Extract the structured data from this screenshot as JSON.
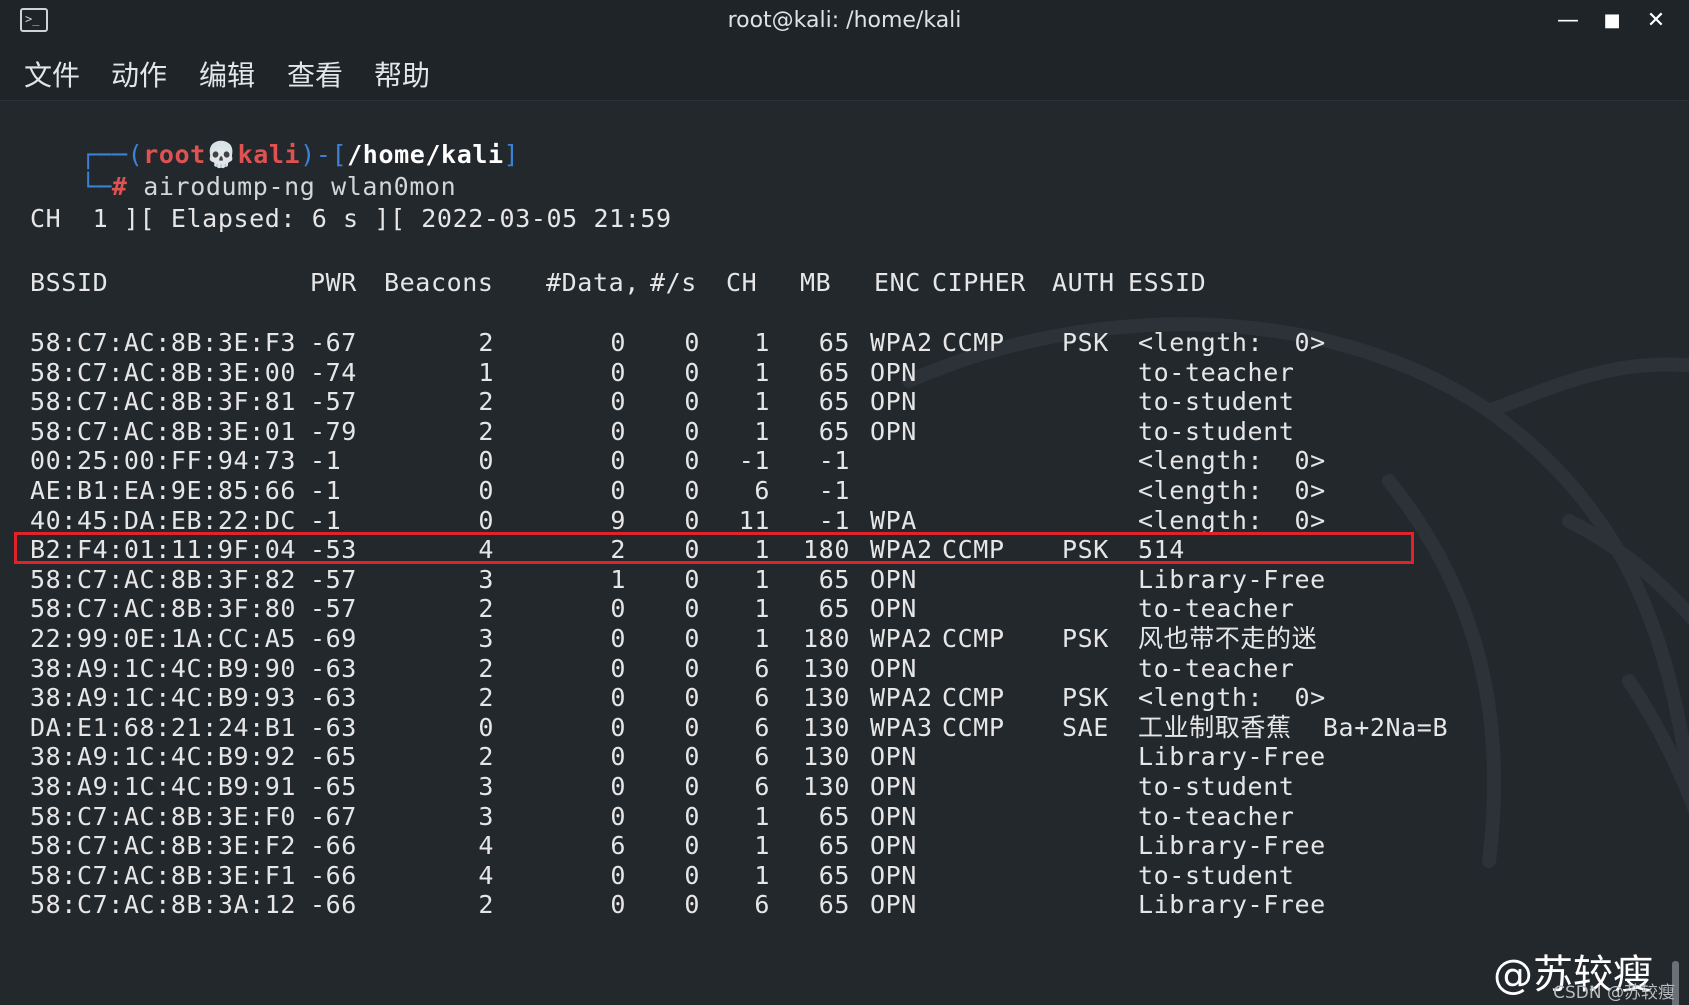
{
  "window": {
    "title": "root@kali: /home/kali",
    "terminal_icon_glyph": ">_",
    "minimize_glyph": "—",
    "maximize_glyph": "■",
    "close_glyph": "✕"
  },
  "menu": [
    "文件",
    "动作",
    "编辑",
    "查看",
    "帮助"
  ],
  "prompt": {
    "open": "┌──(",
    "user": "root",
    "skull": "💀",
    "host": "kali",
    "mid": ")-[",
    "path": "/home/kali",
    "close": "]",
    "corner": "└─",
    "hash": "#",
    "command": "airodump-ng",
    "arg": "wlan0mon"
  },
  "status_line": "CH  1 ][ Elapsed: 6 s ][ 2022-03-05 21:59",
  "columns": [
    "BSSID",
    "PWR",
    "Beacons",
    "#Data,",
    "#/s",
    "CH",
    "MB",
    "ENC",
    "CIPHER",
    "AUTH",
    "ESSID"
  ],
  "rows": [
    {
      "bssid": "58:C7:AC:8B:3E:F3",
      "pwr": "-67",
      "beacons": "2",
      "data": "0",
      "ps": "0",
      "ch": "1",
      "mb": "65",
      "enc": "WPA2",
      "cipher": "CCMP",
      "auth": "PSK",
      "essid": "<length:  0>"
    },
    {
      "bssid": "58:C7:AC:8B:3E:00",
      "pwr": "-74",
      "beacons": "1",
      "data": "0",
      "ps": "0",
      "ch": "1",
      "mb": "65",
      "enc": "OPN",
      "cipher": "",
      "auth": "",
      "essid": "to-teacher"
    },
    {
      "bssid": "58:C7:AC:8B:3F:81",
      "pwr": "-57",
      "beacons": "2",
      "data": "0",
      "ps": "0",
      "ch": "1",
      "mb": "65",
      "enc": "OPN",
      "cipher": "",
      "auth": "",
      "essid": "to-student"
    },
    {
      "bssid": "58:C7:AC:8B:3E:01",
      "pwr": "-79",
      "beacons": "2",
      "data": "0",
      "ps": "0",
      "ch": "1",
      "mb": "65",
      "enc": "OPN",
      "cipher": "",
      "auth": "",
      "essid": "to-student"
    },
    {
      "bssid": "00:25:00:FF:94:73",
      "pwr": "-1",
      "beacons": "0",
      "data": "0",
      "ps": "0",
      "ch": "-1",
      "mb": "-1",
      "enc": "",
      "cipher": "",
      "auth": "",
      "essid": "<length:  0>"
    },
    {
      "bssid": "AE:B1:EA:9E:85:66",
      "pwr": "-1",
      "beacons": "0",
      "data": "0",
      "ps": "0",
      "ch": "6",
      "mb": "-1",
      "enc": "",
      "cipher": "",
      "auth": "",
      "essid": "<length:  0>"
    },
    {
      "bssid": "40:45:DA:EB:22:DC",
      "pwr": "-1",
      "beacons": "0",
      "data": "9",
      "ps": "0",
      "ch": "11",
      "mb": "-1",
      "enc": "WPA",
      "cipher": "",
      "auth": "",
      "essid": "<length:  0>"
    },
    {
      "bssid": "B2:F4:01:11:9F:04",
      "pwr": "-53",
      "beacons": "4",
      "data": "2",
      "ps": "0",
      "ch": "1",
      "mb": "180",
      "enc": "WPA2",
      "cipher": "CCMP",
      "auth": "PSK",
      "essid": "514"
    },
    {
      "bssid": "58:C7:AC:8B:3F:82",
      "pwr": "-57",
      "beacons": "3",
      "data": "1",
      "ps": "0",
      "ch": "1",
      "mb": "65",
      "enc": "OPN",
      "cipher": "",
      "auth": "",
      "essid": "Library-Free"
    },
    {
      "bssid": "58:C7:AC:8B:3F:80",
      "pwr": "-57",
      "beacons": "2",
      "data": "0",
      "ps": "0",
      "ch": "1",
      "mb": "65",
      "enc": "OPN",
      "cipher": "",
      "auth": "",
      "essid": "to-teacher"
    },
    {
      "bssid": "22:99:0E:1A:CC:A5",
      "pwr": "-69",
      "beacons": "3",
      "data": "0",
      "ps": "0",
      "ch": "1",
      "mb": "180",
      "enc": "WPA2",
      "cipher": "CCMP",
      "auth": "PSK",
      "essid": "风也带不走的迷"
    },
    {
      "bssid": "38:A9:1C:4C:B9:90",
      "pwr": "-63",
      "beacons": "2",
      "data": "0",
      "ps": "0",
      "ch": "6",
      "mb": "130",
      "enc": "OPN",
      "cipher": "",
      "auth": "",
      "essid": "to-teacher"
    },
    {
      "bssid": "38:A9:1C:4C:B9:93",
      "pwr": "-63",
      "beacons": "2",
      "data": "0",
      "ps": "0",
      "ch": "6",
      "mb": "130",
      "enc": "WPA2",
      "cipher": "CCMP",
      "auth": "PSK",
      "essid": "<length:  0>"
    },
    {
      "bssid": "DA:E1:68:21:24:B1",
      "pwr": "-63",
      "beacons": "0",
      "data": "0",
      "ps": "0",
      "ch": "6",
      "mb": "130",
      "enc": "WPA3",
      "cipher": "CCMP",
      "auth": "SAE",
      "essid": "工业制取香蕉  Ba+2Na=B"
    },
    {
      "bssid": "38:A9:1C:4C:B9:92",
      "pwr": "-65",
      "beacons": "2",
      "data": "0",
      "ps": "0",
      "ch": "6",
      "mb": "130",
      "enc": "OPN",
      "cipher": "",
      "auth": "",
      "essid": "Library-Free"
    },
    {
      "bssid": "38:A9:1C:4C:B9:91",
      "pwr": "-65",
      "beacons": "3",
      "data": "0",
      "ps": "0",
      "ch": "6",
      "mb": "130",
      "enc": "OPN",
      "cipher": "",
      "auth": "",
      "essid": "to-student"
    },
    {
      "bssid": "58:C7:AC:8B:3E:F0",
      "pwr": "-67",
      "beacons": "3",
      "data": "0",
      "ps": "0",
      "ch": "1",
      "mb": "65",
      "enc": "OPN",
      "cipher": "",
      "auth": "",
      "essid": "to-teacher"
    },
    {
      "bssid": "58:C7:AC:8B:3E:F2",
      "pwr": "-66",
      "beacons": "4",
      "data": "6",
      "ps": "0",
      "ch": "1",
      "mb": "65",
      "enc": "OPN",
      "cipher": "",
      "auth": "",
      "essid": "Library-Free"
    },
    {
      "bssid": "58:C7:AC:8B:3E:F1",
      "pwr": "-66",
      "beacons": "4",
      "data": "0",
      "ps": "0",
      "ch": "1",
      "mb": "65",
      "enc": "OPN",
      "cipher": "",
      "auth": "",
      "essid": "to-student"
    },
    {
      "bssid": "58:C7:AC:8B:3A:12",
      "pwr": "-66",
      "beacons": "2",
      "data": "0",
      "ps": "0",
      "ch": "6",
      "mb": "65",
      "enc": "OPN",
      "cipher": "",
      "auth": "",
      "essid": "Library-Free"
    }
  ],
  "highlighted_bssid": "B2:F4:01:11:9F:04",
  "watermark": {
    "big": "@苏较瘦",
    "small": "CSDN @苏较瘦"
  },
  "colors": {
    "background": "#23282d",
    "highlight_border": "#e0222a",
    "prompt_frame": "#3b82d6",
    "prompt_user": "#e05252"
  }
}
